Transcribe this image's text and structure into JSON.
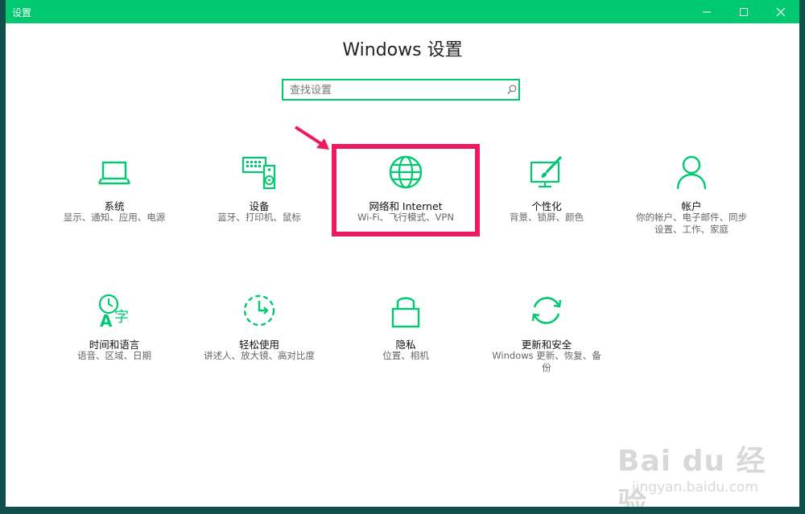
{
  "window": {
    "title": "设置"
  },
  "header": {
    "title": "Windows 设置"
  },
  "search": {
    "placeholder": "查找设置"
  },
  "tiles": [
    {
      "name": "系统",
      "desc": "显示、通知、应用、电源",
      "icon": "laptop-icon"
    },
    {
      "name": "设备",
      "desc": "蓝牙、打印机、鼠标",
      "icon": "keyboard-speaker-icon"
    },
    {
      "name": "网络和 Internet",
      "desc": "Wi-Fi、飞行模式、VPN",
      "icon": "globe-icon"
    },
    {
      "name": "个性化",
      "desc": "背景、锁屏、颜色",
      "icon": "paint-icon"
    },
    {
      "name": "帐户",
      "desc_lines": [
        "你的帐户、电子邮件、同步",
        "设置、工作、家庭"
      ],
      "icon": "person-icon"
    },
    {
      "name": "时间和语言",
      "desc": "语音、区域、日期",
      "icon": "time-language-icon"
    },
    {
      "name": "轻松使用",
      "desc": "讲述人、放大镜、高对比度",
      "icon": "ease-of-access-icon"
    },
    {
      "name": "隐私",
      "desc": "位置、相机",
      "icon": "lock-icon"
    },
    {
      "name": "更新和安全",
      "desc_lines": [
        "Windows 更新、恢复、备",
        "份"
      ],
      "icon": "update-icon"
    }
  ],
  "watermark": {
    "logo": "Bai du 经验",
    "sub": "jingyan.baidu.com"
  },
  "colors": {
    "accent": "#00c96f",
    "highlight": "#ee1a5e"
  }
}
